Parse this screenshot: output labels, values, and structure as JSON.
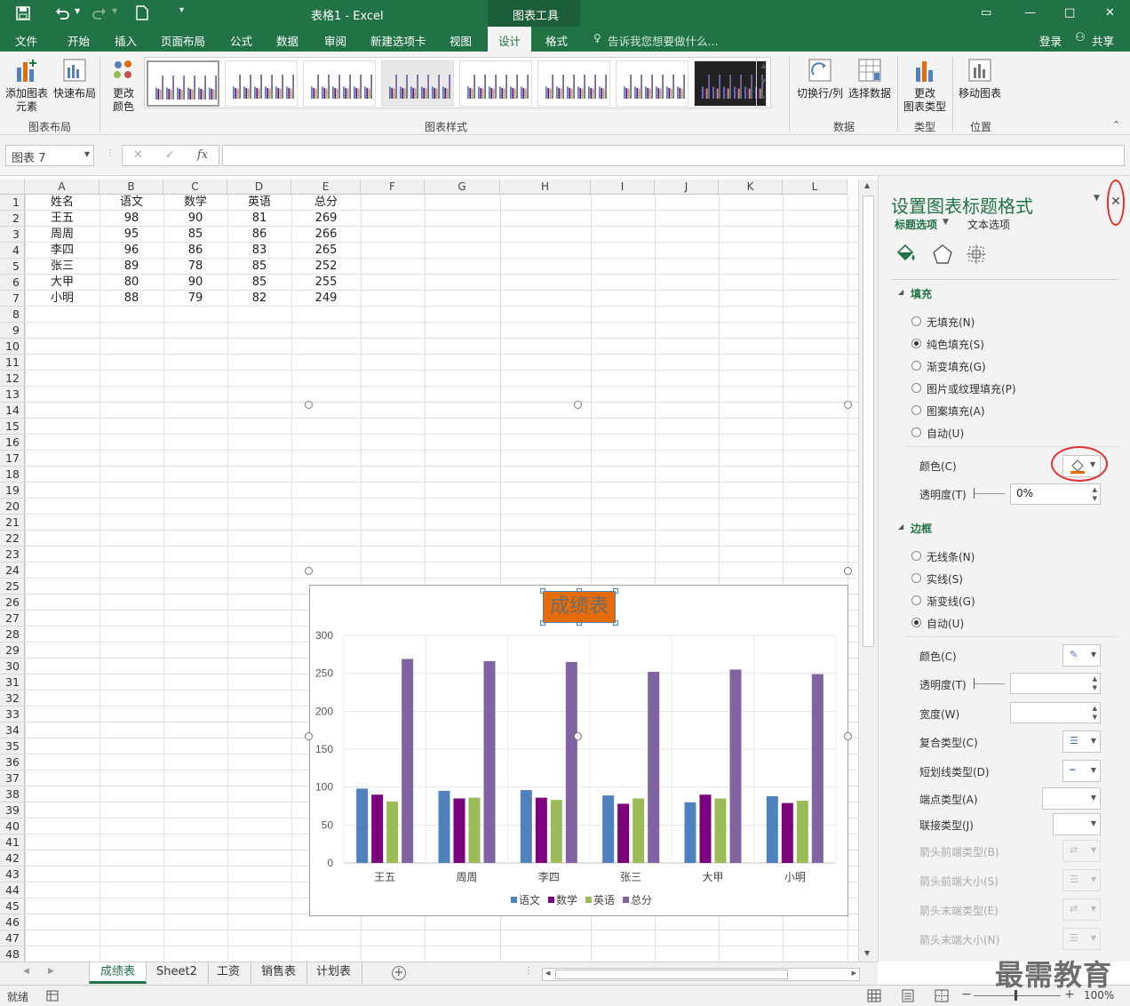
{
  "window": {
    "title": "表格1 - Excel",
    "context_tab": "图表工具",
    "restore": "▭",
    "minimize": "—",
    "maximize": "□",
    "close": "✕"
  },
  "tabs": [
    "文件",
    "开始",
    "插入",
    "页面布局",
    "公式",
    "数据",
    "审阅",
    "新建选项卡",
    "视图",
    "设计",
    "格式"
  ],
  "active_tab": "设计",
  "tell_me": "告诉我您想要做什么...",
  "account": {
    "login": "登录",
    "share": "共享"
  },
  "ribbon": {
    "add_element": "添加图表\n元素",
    "quick_layout": "快速布局",
    "change_colors": "更改\n颜色",
    "switch_row_col": "切换行/列",
    "select_data": "选择数据",
    "change_type": "更改\n图表类型",
    "move_chart": "移动图表",
    "groups": {
      "layout": "图表布局",
      "styles": "图表样式",
      "data": "数据",
      "type": "类型",
      "location": "位置"
    }
  },
  "formula_bar": {
    "name_box": "图表 7",
    "fx": "fx",
    "cancel": "✕",
    "enter": "✓",
    "value": ""
  },
  "columns": [
    "A",
    "B",
    "C",
    "D",
    "E",
    "F",
    "G",
    "H",
    "I",
    "J",
    "K",
    "L"
  ],
  "rows": 48,
  "table": {
    "headers": [
      "姓名",
      "语文",
      "数学",
      "英语",
      "总分"
    ],
    "rows": [
      [
        "王五",
        "98",
        "90",
        "81",
        "269"
      ],
      [
        "周周",
        "95",
        "85",
        "86",
        "266"
      ],
      [
        "李四",
        "96",
        "86",
        "83",
        "265"
      ],
      [
        "张三",
        "89",
        "78",
        "85",
        "252"
      ],
      [
        "大甲",
        "80",
        "90",
        "85",
        "255"
      ],
      [
        "小明",
        "88",
        "79",
        "82",
        "249"
      ]
    ]
  },
  "chart_data": {
    "type": "bar",
    "title": "成绩表",
    "categories": [
      "王五",
      "周周",
      "李四",
      "张三",
      "大甲",
      "小明"
    ],
    "series": [
      {
        "name": "语文",
        "values": [
          98,
          95,
          96,
          89,
          80,
          88
        ],
        "color": "#4f81bd"
      },
      {
        "name": "数学",
        "values": [
          90,
          85,
          86,
          78,
          90,
          79
        ],
        "color": "#7b007b"
      },
      {
        "name": "英语",
        "values": [
          81,
          86,
          83,
          85,
          85,
          82
        ],
        "color": "#9bbb59"
      },
      {
        "name": "总分",
        "values": [
          269,
          266,
          265,
          252,
          255,
          249
        ],
        "color": "#8064a2"
      }
    ],
    "ylim": [
      0,
      300
    ],
    "yticks": [
      "0",
      "50",
      "100",
      "150",
      "200",
      "250",
      "300"
    ],
    "legend": "bottom",
    "title_fill": "#e46c0a"
  },
  "panel": {
    "title": "设置图表标题格式",
    "tab_title_options": "标题选项",
    "tab_text_options": "文本选项",
    "fill_section": "填充",
    "fill_options": [
      "无填充(N)",
      "纯色填充(S)",
      "渐变填充(G)",
      "图片或纹理填充(P)",
      "图案填充(A)",
      "自动(U)"
    ],
    "fill_selected": 1,
    "color_label": "颜色(C)",
    "transparency_label": "透明度(T)",
    "transparency_value": "0%",
    "border_section": "边框",
    "border_options": [
      "无线条(N)",
      "实线(S)",
      "渐变线(G)",
      "自动(U)"
    ],
    "border_selected": 3,
    "border_props": [
      "颜色(C)",
      "透明度(T)",
      "宽度(W)",
      "复合类型(C)",
      "短划线类型(D)",
      "端点类型(A)",
      "联接类型(J)"
    ],
    "border_props_disabled": [
      "箭头前端类型(B)",
      "箭头前端大小(S)",
      "箭头末端类型(E)",
      "箭头末端大小(N)"
    ]
  },
  "sheet_tabs": [
    "成绩表",
    "Sheet2",
    "工资",
    "销售表",
    "计划表"
  ],
  "active_sheet": "成绩表",
  "status": {
    "ready": "就绪",
    "zoom": "100%"
  },
  "watermark": "最需教育"
}
